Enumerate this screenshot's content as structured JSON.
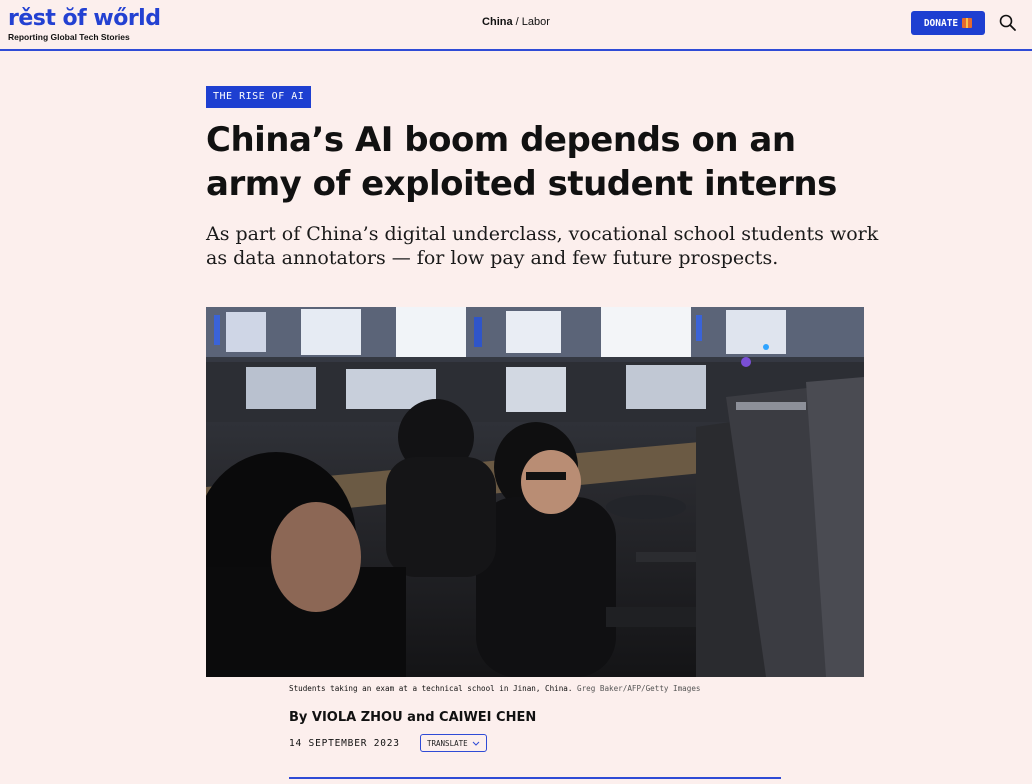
{
  "header": {
    "logo_text": "rěst ŏf wőrld",
    "tagline": "Reporting Global Tech Stories",
    "category": "China",
    "separator": "/",
    "subcategory": "Labor",
    "donate_label": "DONATE",
    "icons": [
      "gift-icon",
      "search-icon"
    ],
    "accent_color": "#1e3fd1"
  },
  "article": {
    "kicker": "THE RISE OF AI",
    "headline": "China’s AI boom depends on an army of exploited student interns",
    "dek": "As part of China’s digital underclass, vocational school students work as data annotators — for low pay and few future prospects.",
    "caption": "Students taking an exam at a technical school in Jinan, China.",
    "credit": "Greg Baker/AFP/Getty Images",
    "byline": "By VIOLA ZHOU and CAIWEI CHEN",
    "date": "14 SEPTEMBER 2023",
    "translate_label": "TRANSLATE"
  }
}
